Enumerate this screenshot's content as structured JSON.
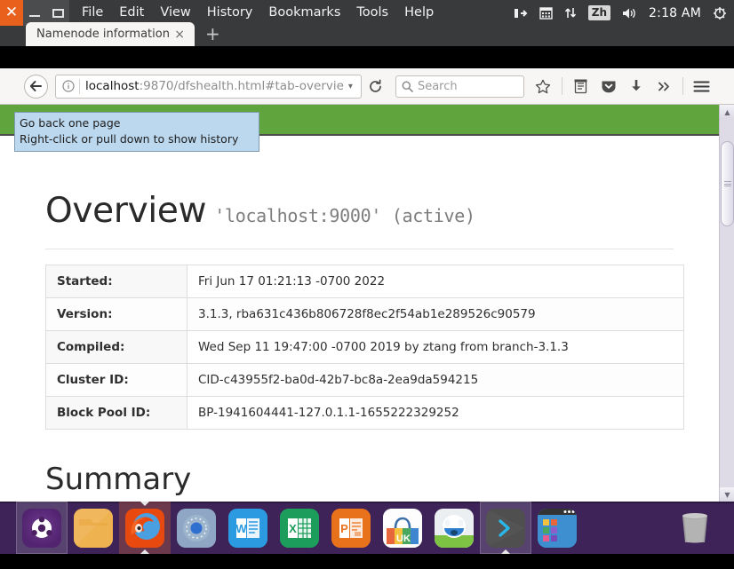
{
  "window": {
    "controls": {
      "close": "close-button",
      "minimize": "minimize-button",
      "maximize": "maximize-button"
    },
    "menu": [
      "File",
      "Edit",
      "View",
      "History",
      "Bookmarks",
      "Tools",
      "Help"
    ]
  },
  "tray": {
    "icons": [
      "network-icon",
      "calendar-icon",
      "sync-transfer-icon",
      "volume-icon",
      "power-gear-icon"
    ],
    "input_method": "Zh",
    "time": "2:18 AM"
  },
  "tabs": {
    "active": {
      "title": "Namenode information",
      "close_label": "×"
    },
    "new_tab_label": "+"
  },
  "toolbar": {
    "back_icon": "back-arrow-icon",
    "identity_icon": "info-icon",
    "url_host": "localhost",
    "url_rest": ":9870/dfshealth.html#tab-overvie",
    "url_caret": "▾",
    "reload_icon": "reload-icon",
    "search_placeholder": "Search",
    "icons": [
      "bookmark-star-icon",
      "reader-list-icon",
      "pocket-shield-icon",
      "downloads-icon",
      "overflow-chevrons-icon",
      "hamburger-menu-icon"
    ]
  },
  "tooltip": {
    "line1": "Go back one page",
    "line2": "Right-click or pull down to show history"
  },
  "page": {
    "navbar_color": "#5fa43c",
    "heading": "Overview",
    "heading_suffix": "'localhost:9000' (active)",
    "table": [
      {
        "label": "Started:",
        "value": "Fri Jun 17 01:21:13 -0700 2022"
      },
      {
        "label": "Version:",
        "value": "3.1.3, rba631c436b806728f8ec2f54ab1e289526c90579"
      },
      {
        "label": "Compiled:",
        "value": "Wed Sep 11 19:47:00 -0700 2019 by ztang from branch-3.1.3"
      },
      {
        "label": "Cluster ID:",
        "value": "CID-c43955f2-ba0d-42b7-bc8a-2ea9da594215"
      },
      {
        "label": "Block Pool ID:",
        "value": "BP-1941604441-127.0.1.1-1655222329252"
      }
    ],
    "summary_heading": "Summary"
  },
  "scrollbar": {
    "up": "▲",
    "down": "▼"
  },
  "dock": {
    "background": "#3d2358",
    "items": [
      {
        "name": "ubuntu-launcher-icon",
        "active": true
      },
      {
        "name": "files-folder-icon",
        "active": false
      },
      {
        "name": "firefox-icon",
        "active": true
      },
      {
        "name": "chromium-browser-icon",
        "active": false
      },
      {
        "name": "word-icon",
        "label": "W",
        "active": false
      },
      {
        "name": "excel-icon",
        "label": "X",
        "active": false
      },
      {
        "name": "powerpoint-icon",
        "label": "P",
        "active": false
      },
      {
        "name": "ubuntu-software-icon",
        "label": "UK",
        "active": false
      },
      {
        "name": "help-assistant-icon",
        "active": false
      },
      {
        "name": "terminal-icon",
        "label": ">",
        "active": true
      },
      {
        "name": "app-grid-icon",
        "active": false
      }
    ],
    "trash": {
      "name": "trash-icon"
    }
  }
}
